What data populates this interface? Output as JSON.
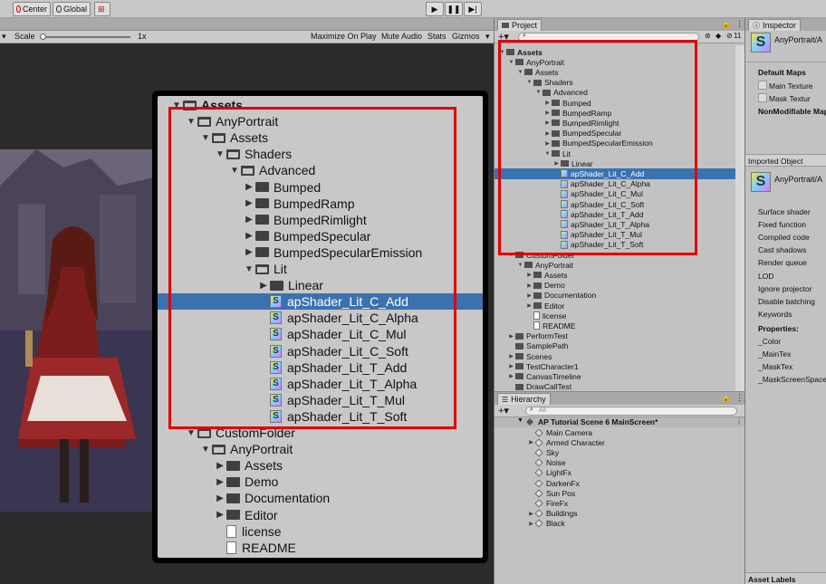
{
  "toolbar": {
    "center_label": "Center",
    "global_label": "Global"
  },
  "game": {
    "scale_label": "Scale",
    "scale_value": "1x",
    "maximize_label": "Maximize On Play",
    "mute_label": "Mute Audio",
    "stats_label": "Stats",
    "gizmos_label": "Gizmos"
  },
  "zoom_tree": [
    {
      "label": "Assets",
      "depth": 0,
      "type": "folder-open",
      "arrow": "▼"
    },
    {
      "label": "AnyPortrait",
      "depth": 1,
      "type": "folder-open",
      "arrow": "▼"
    },
    {
      "label": "Assets",
      "depth": 2,
      "type": "folder-open",
      "arrow": "▼"
    },
    {
      "label": "Shaders",
      "depth": 3,
      "type": "folder-open",
      "arrow": "▼"
    },
    {
      "label": "Advanced",
      "depth": 4,
      "type": "folder-open",
      "arrow": "▼"
    },
    {
      "label": "Bumped",
      "depth": 5,
      "type": "folder",
      "arrow": "▶"
    },
    {
      "label": "BumpedRamp",
      "depth": 5,
      "type": "folder",
      "arrow": "▶"
    },
    {
      "label": "BumpedRimlight",
      "depth": 5,
      "type": "folder",
      "arrow": "▶"
    },
    {
      "label": "BumpedSpecular",
      "depth": 5,
      "type": "folder",
      "arrow": "▶"
    },
    {
      "label": "BumpedSpecularEmission",
      "depth": 5,
      "type": "folder",
      "arrow": "▶"
    },
    {
      "label": "Lit",
      "depth": 5,
      "type": "folder-open",
      "arrow": "▼"
    },
    {
      "label": "Linear",
      "depth": 6,
      "type": "folder",
      "arrow": "▶"
    },
    {
      "label": "apShader_Lit_C_Add",
      "depth": 6,
      "type": "shader",
      "arrow": "",
      "selected": true
    },
    {
      "label": "apShader_Lit_C_Alpha",
      "depth": 6,
      "type": "shader",
      "arrow": ""
    },
    {
      "label": "apShader_Lit_C_Mul",
      "depth": 6,
      "type": "shader",
      "arrow": ""
    },
    {
      "label": "apShader_Lit_C_Soft",
      "depth": 6,
      "type": "shader",
      "arrow": ""
    },
    {
      "label": "apShader_Lit_T_Add",
      "depth": 6,
      "type": "shader",
      "arrow": ""
    },
    {
      "label": "apShader_Lit_T_Alpha",
      "depth": 6,
      "type": "shader",
      "arrow": ""
    },
    {
      "label": "apShader_Lit_T_Mul",
      "depth": 6,
      "type": "shader",
      "arrow": ""
    },
    {
      "label": "apShader_Lit_T_Soft",
      "depth": 6,
      "type": "shader",
      "arrow": ""
    },
    {
      "label": "CustomFolder",
      "depth": 1,
      "type": "folder-open",
      "arrow": "▼"
    },
    {
      "label": "AnyPortrait",
      "depth": 2,
      "type": "folder-open",
      "arrow": "▼"
    },
    {
      "label": "Assets",
      "depth": 3,
      "type": "folder",
      "arrow": "▶"
    },
    {
      "label": "Demo",
      "depth": 3,
      "type": "folder",
      "arrow": "▶"
    },
    {
      "label": "Documentation",
      "depth": 3,
      "type": "folder",
      "arrow": "▶"
    },
    {
      "label": "Editor",
      "depth": 3,
      "type": "folder",
      "arrow": "▶"
    },
    {
      "label": "license",
      "depth": 3,
      "type": "file",
      "arrow": ""
    },
    {
      "label": "README",
      "depth": 3,
      "type": "file",
      "arrow": ""
    }
  ],
  "project": {
    "tab_label": "Project",
    "search_count": "11",
    "tree": [
      {
        "label": "Assets",
        "depth": 0,
        "type": "folder-open",
        "arrow": "▼",
        "bold": true
      },
      {
        "label": "AnyPortrait",
        "depth": 1,
        "type": "folder-open",
        "arrow": "▼"
      },
      {
        "label": "Assets",
        "depth": 2,
        "type": "folder-open",
        "arrow": "▼"
      },
      {
        "label": "Shaders",
        "depth": 3,
        "type": "folder-open",
        "arrow": "▼"
      },
      {
        "label": "Advanced",
        "depth": 4,
        "type": "folder-open",
        "arrow": "▼"
      },
      {
        "label": "Bumped",
        "depth": 5,
        "type": "folder",
        "arrow": "▶"
      },
      {
        "label": "BumpedRamp",
        "depth": 5,
        "type": "folder",
        "arrow": "▶"
      },
      {
        "label": "BumpedRimlight",
        "depth": 5,
        "type": "folder",
        "arrow": "▶"
      },
      {
        "label": "BumpedSpecular",
        "depth": 5,
        "type": "folder",
        "arrow": "▶"
      },
      {
        "label": "BumpedSpecularEmission",
        "depth": 5,
        "type": "folder",
        "arrow": "▶"
      },
      {
        "label": "Lit",
        "depth": 5,
        "type": "folder-open",
        "arrow": "▼"
      },
      {
        "label": "Linear",
        "depth": 6,
        "type": "folder",
        "arrow": "▶"
      },
      {
        "label": "apShader_Lit_C_Add",
        "depth": 6,
        "type": "shader",
        "arrow": "",
        "selected": true
      },
      {
        "label": "apShader_Lit_C_Alpha",
        "depth": 6,
        "type": "shader",
        "arrow": ""
      },
      {
        "label": "apShader_Lit_C_Mul",
        "depth": 6,
        "type": "shader",
        "arrow": ""
      },
      {
        "label": "apShader_Lit_C_Soft",
        "depth": 6,
        "type": "shader",
        "arrow": ""
      },
      {
        "label": "apShader_Lit_T_Add",
        "depth": 6,
        "type": "shader",
        "arrow": ""
      },
      {
        "label": "apShader_Lit_T_Alpha",
        "depth": 6,
        "type": "shader",
        "arrow": ""
      },
      {
        "label": "apShader_Lit_T_Mul",
        "depth": 6,
        "type": "shader",
        "arrow": ""
      },
      {
        "label": "apShader_Lit_T_Soft",
        "depth": 6,
        "type": "shader",
        "arrow": ""
      },
      {
        "label": "CustomFolder",
        "depth": 1,
        "type": "folder-open",
        "arrow": "▼"
      },
      {
        "label": "AnyPortrait",
        "depth": 2,
        "type": "folder-open",
        "arrow": "▼"
      },
      {
        "label": "Assets",
        "depth": 3,
        "type": "folder",
        "arrow": "▶"
      },
      {
        "label": "Demo",
        "depth": 3,
        "type": "folder",
        "arrow": "▶"
      },
      {
        "label": "Documentation",
        "depth": 3,
        "type": "folder",
        "arrow": "▶"
      },
      {
        "label": "Editor",
        "depth": 3,
        "type": "folder",
        "arrow": "▶"
      },
      {
        "label": "license",
        "depth": 3,
        "type": "file",
        "arrow": ""
      },
      {
        "label": "README",
        "depth": 3,
        "type": "file",
        "arrow": ""
      },
      {
        "label": "PerformTest",
        "depth": 1,
        "type": "folder",
        "arrow": "▶"
      },
      {
        "label": "SamplePath",
        "depth": 1,
        "type": "folder",
        "arrow": ""
      },
      {
        "label": "Scenes",
        "depth": 1,
        "type": "folder",
        "arrow": "▶"
      },
      {
        "label": "TestCharacter1",
        "depth": 1,
        "type": "folder",
        "arrow": "▶"
      },
      {
        "label": "CanvasTimeline",
        "depth": 1,
        "type": "folder",
        "arrow": "▶"
      },
      {
        "label": "DrawCallTest",
        "depth": 1,
        "type": "folder",
        "arrow": ""
      }
    ]
  },
  "hierarchy": {
    "tab_label": "Hierarchy",
    "search_placeholder": "All",
    "scene_label": "AP Tutorial Scene 6 MainScreen*",
    "items": [
      {
        "label": "Main Camera",
        "arrow": ""
      },
      {
        "label": "Armed Character",
        "arrow": "▶"
      },
      {
        "label": "Sky",
        "arrow": ""
      },
      {
        "label": "Noise",
        "arrow": ""
      },
      {
        "label": "LightFx",
        "arrow": ""
      },
      {
        "label": "DarkenFx",
        "arrow": ""
      },
      {
        "label": "Sun Pos",
        "arrow": ""
      },
      {
        "label": "FireFx",
        "arrow": ""
      },
      {
        "label": "Buildings",
        "arrow": "▶"
      },
      {
        "label": "Black",
        "arrow": "▶"
      }
    ]
  },
  "inspector": {
    "tab_label": "Inspector",
    "asset_path": "AnyPortrait/A",
    "default_maps_label": "Default Maps",
    "main_texture_label": "Main Texture",
    "mask_texture_label": "Mask Textur",
    "nonmodifiable_label": "NonModifiable Map",
    "imported_object_label": "Imported Object",
    "imported_path": "AnyPortrait/A",
    "details": [
      "Surface shader",
      "Fixed function",
      "Compiled code",
      "Cast shadows",
      "Render queue",
      "LOD",
      "Ignore projector",
      "Disable batching",
      "Keywords"
    ],
    "properties_label": "Properties:",
    "properties": [
      "_Color",
      "_MainTex",
      "_MaskTex",
      "_MaskScreenSpace"
    ],
    "asset_labels": "Asset Labels"
  },
  "colors": {
    "selection": "#3a72b0",
    "highlight_red": "#e00000"
  }
}
